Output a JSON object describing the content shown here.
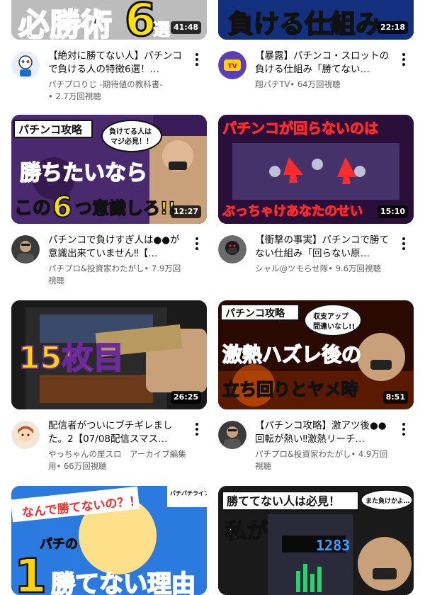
{
  "videos": [
    {
      "title": "【絶対に勝てない人】パチンコで負ける人の特徴6選！…",
      "channel": "パチプロりじ -期待値の教科書-",
      "views": "• 2.7万回視聴",
      "duration": "41:48",
      "thumb_text": [
        "必勝術",
        "6",
        "選"
      ],
      "thumb_colors": [
        "#e8e8e8",
        "#111111",
        "#ffe100"
      ],
      "avatar_icon": "robot-mascot-avatar-icon"
    },
    {
      "title": "【暴露】パチンコ・スロットの負ける仕組み「勝てない…",
      "channel": "翔パチTV",
      "views": "• 64万回視聴",
      "duration": "22:18",
      "thumb_text": [
        "負ける仕組み"
      ],
      "thumb_colors": [
        "#0a1a5c",
        "#ffd400"
      ],
      "avatar_icon": "tv-logo-avatar-icon"
    },
    {
      "title": "パチンコで負けすぎ人は●●が意識出来ていません‼【…",
      "channel": "パチプロ&投資家わたがし",
      "views": "• 7.9万回視聴",
      "duration": "12:27",
      "thumb_text": [
        "パチンコ攻略",
        "負けてる人は",
        "マジ必見！！",
        "勝ちたいなら",
        "この",
        "6",
        "つ意識しろ!!"
      ],
      "thumb_colors": [
        "#3a1c5a",
        "#ff2a2a",
        "#ffe100"
      ],
      "avatar_icon": "person-avatar-icon"
    },
    {
      "title": "【衝撃の事実】パチンコで勝てない仕組み「回らない原…",
      "channel": "シャル@ツモらせ隊",
      "views": "• 9.6万回視聴",
      "duration": "15:10",
      "thumb_text": [
        "パチンコが回らないのは",
        "ぶっちゃけあなたのせい"
      ],
      "thumb_colors": [
        "#2a0f3a",
        "#ff2a2a",
        "#ffe100"
      ],
      "avatar_icon": "masked-person-avatar-icon"
    },
    {
      "title": "配信者がついにブチギレました。2【07/08配信スマス…",
      "channel": "やっちゃんの崖スロ　アーカイブ編集用",
      "views": "• 66万回視聴",
      "duration": "26:25",
      "thumb_text": [
        "15枚目"
      ],
      "thumb_colors": [
        "#1a1a1a",
        "#ffd400"
      ],
      "avatar_icon": "anime-character-avatar-icon"
    },
    {
      "title": "【パチンコ攻略】激アツ後●●回転が熱い‼激熱リーチ…",
      "channel": "パチプロ&投資家わたがし",
      "views": "• 4.9万回視聴",
      "duration": "8:51",
      "thumb_text": [
        "パチンコ攻略",
        "収支アップ",
        "間違いなし!!",
        "激熱ハズレ後の",
        "立ち回りとヤメ時"
      ],
      "thumb_colors": [
        "#2a0a00",
        "#ff2a2a",
        "#ffe100"
      ],
      "avatar_icon": "person-avatar-icon"
    },
    {
      "title": "",
      "channel": "",
      "views": "",
      "duration": "",
      "thumb_text": [
        "なんで勝てないの？！",
        "パチパチライフ",
        "パチの",
        "1",
        "勝てない理由"
      ],
      "thumb_colors": [
        "#2a7ae0",
        "#ffd400",
        "#ff2a2a"
      ],
      "avatar_icon": ""
    },
    {
      "title": "",
      "channel": "",
      "views": "",
      "duration": "",
      "thumb_text": [
        "勝ててない人は必見！",
        "また負けかよ…",
        "私が",
        "1283"
      ],
      "thumb_colors": [
        "#1a1a1a",
        "#ffffff",
        "#ff2a2a"
      ],
      "avatar_icon": ""
    }
  ]
}
